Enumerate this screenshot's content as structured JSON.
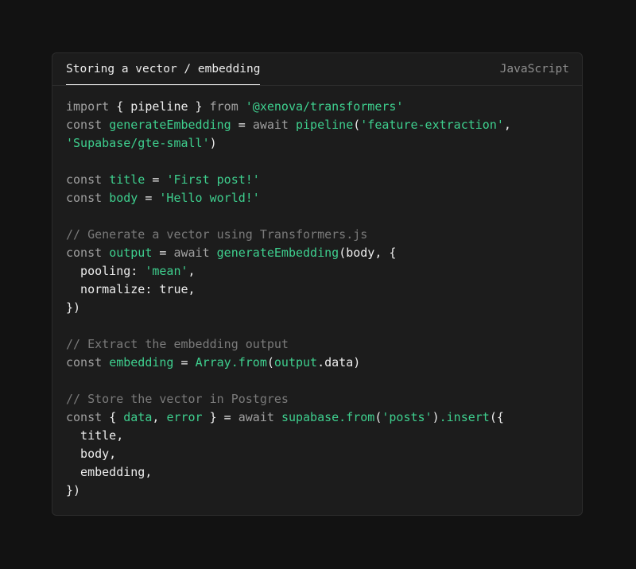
{
  "header": {
    "tab_label": "Storing a vector / embedding",
    "language": "JavaScript"
  },
  "colors": {
    "background": "#121212",
    "panel": "#1c1c1c",
    "keyword": "#a0a0a0",
    "identifier": "#ededed",
    "accent_green": "#3ecf8e",
    "comment": "#7a7a7a"
  },
  "code_lines": [
    [
      [
        "kw",
        "import "
      ],
      [
        "p",
        "{ "
      ],
      [
        "id",
        "pipeline"
      ],
      [
        "p",
        " } "
      ],
      [
        "kw",
        "from "
      ],
      [
        "str",
        "'@xenova/transformers'"
      ]
    ],
    [
      [
        "kw",
        "const "
      ],
      [
        "fn",
        "generateEmbedding"
      ],
      [
        "p",
        " = "
      ],
      [
        "kw",
        "await "
      ],
      [
        "fn",
        "pipeline"
      ],
      [
        "p",
        "("
      ],
      [
        "str",
        "'feature-extraction'"
      ],
      [
        "p",
        ","
      ]
    ],
    [
      [
        "str",
        "'Supabase/gte-small'"
      ],
      [
        "p",
        ")"
      ]
    ],
    [],
    [
      [
        "kw",
        "const "
      ],
      [
        "fn",
        "title"
      ],
      [
        "p",
        " = "
      ],
      [
        "str",
        "'First post!'"
      ]
    ],
    [
      [
        "kw",
        "const "
      ],
      [
        "fn",
        "body"
      ],
      [
        "p",
        " = "
      ],
      [
        "str",
        "'Hello world!'"
      ]
    ],
    [],
    [
      [
        "cm",
        "// Generate a vector using Transformers.js"
      ]
    ],
    [
      [
        "kw",
        "const "
      ],
      [
        "fn",
        "output"
      ],
      [
        "p",
        " = "
      ],
      [
        "kw",
        "await "
      ],
      [
        "fn",
        "generateEmbedding"
      ],
      [
        "p",
        "(body, {"
      ]
    ],
    [
      [
        "p",
        "  pooling: "
      ],
      [
        "str",
        "'mean'"
      ],
      [
        "p",
        ","
      ]
    ],
    [
      [
        "p",
        "  normalize: true,"
      ]
    ],
    [
      [
        "p",
        "})"
      ]
    ],
    [],
    [
      [
        "cm",
        "// Extract the embedding output"
      ]
    ],
    [
      [
        "kw",
        "const "
      ],
      [
        "fn",
        "embedding"
      ],
      [
        "p",
        " = "
      ],
      [
        "fn",
        "Array.from"
      ],
      [
        "p",
        "("
      ],
      [
        "fn",
        "output"
      ],
      [
        "p",
        ".data)"
      ]
    ],
    [],
    [
      [
        "cm",
        "// Store the vector in Postgres"
      ]
    ],
    [
      [
        "kw",
        "const "
      ],
      [
        "p",
        "{ "
      ],
      [
        "fn",
        "data"
      ],
      [
        "p",
        ", "
      ],
      [
        "fn",
        "error"
      ],
      [
        "p",
        " } = "
      ],
      [
        "kw",
        "await "
      ],
      [
        "fn",
        "supabase.from"
      ],
      [
        "p",
        "("
      ],
      [
        "str",
        "'posts'"
      ],
      [
        "p",
        ")"
      ],
      [
        "fn",
        ".insert"
      ],
      [
        "p",
        "({"
      ]
    ],
    [
      [
        "p",
        "  title,"
      ]
    ],
    [
      [
        "p",
        "  body,"
      ]
    ],
    [
      [
        "p",
        "  embedding,"
      ]
    ],
    [
      [
        "p",
        "})"
      ]
    ]
  ]
}
